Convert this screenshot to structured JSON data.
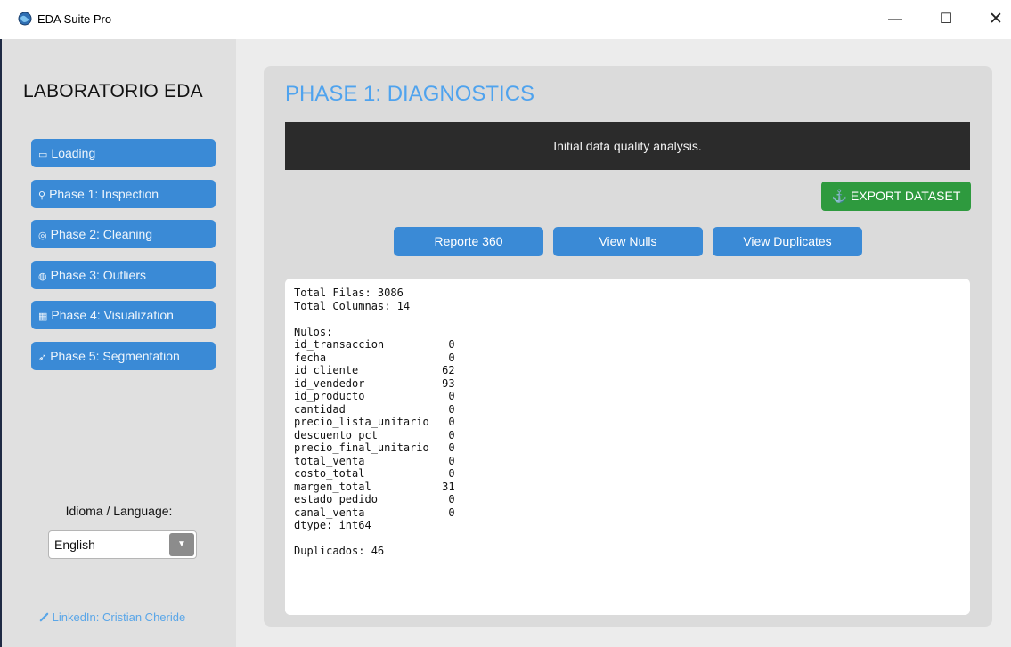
{
  "window": {
    "title": "EDA Suite Pro",
    "controls": {
      "minimize": "—",
      "maximize": "☐",
      "close": "✕"
    }
  },
  "sidebar": {
    "brand": "LABORATORIO EDA",
    "items": [
      {
        "icon": "folder-icon",
        "glyph": "▭",
        "label": "Loading"
      },
      {
        "icon": "search-icon",
        "glyph": "⚲",
        "label": "Phase 1: Inspection"
      },
      {
        "icon": "cleaning-icon",
        "glyph": "◎",
        "label": "Phase 2: Cleaning"
      },
      {
        "icon": "outliers-icon",
        "glyph": "◍",
        "label": "Phase 3: Outliers"
      },
      {
        "icon": "chart-icon",
        "glyph": "▦",
        "label": "Phase 4: Visualization"
      },
      {
        "icon": "rocket-icon",
        "glyph": "➶",
        "label": "Phase 5: Segmentation"
      }
    ],
    "language_label": "Idioma / Language:",
    "language_value": "English",
    "linkedin": "LinkedIn: Cristian Cheride"
  },
  "main": {
    "phase_title": "PHASE 1: DIAGNOSTICS",
    "banner": "Initial data quality analysis.",
    "export_label": "⚓ EXPORT DATASET",
    "buttons": [
      "Reporte 360",
      "View Nulls",
      "View Duplicates"
    ],
    "report": "Total Filas: 3086\nTotal Columnas: 14\n\nNulos:\nid_transaccion          0\nfecha                   0\nid_cliente             62\nid_vendedor            93\nid_producto             0\ncantidad                0\nprecio_lista_unitario   0\ndescuento_pct           0\nprecio_final_unitario   0\ntotal_venta             0\ncosto_total             0\nmargen_total           31\nestado_pedido           0\ncanal_venta             0\ndtype: int64\n\nDuplicados: 46"
  },
  "colors": {
    "accent_blue": "#3a8ad6",
    "title_blue": "#4fa3ee",
    "export_green": "#2e9a3e",
    "banner_dark": "#2b2b2b"
  }
}
